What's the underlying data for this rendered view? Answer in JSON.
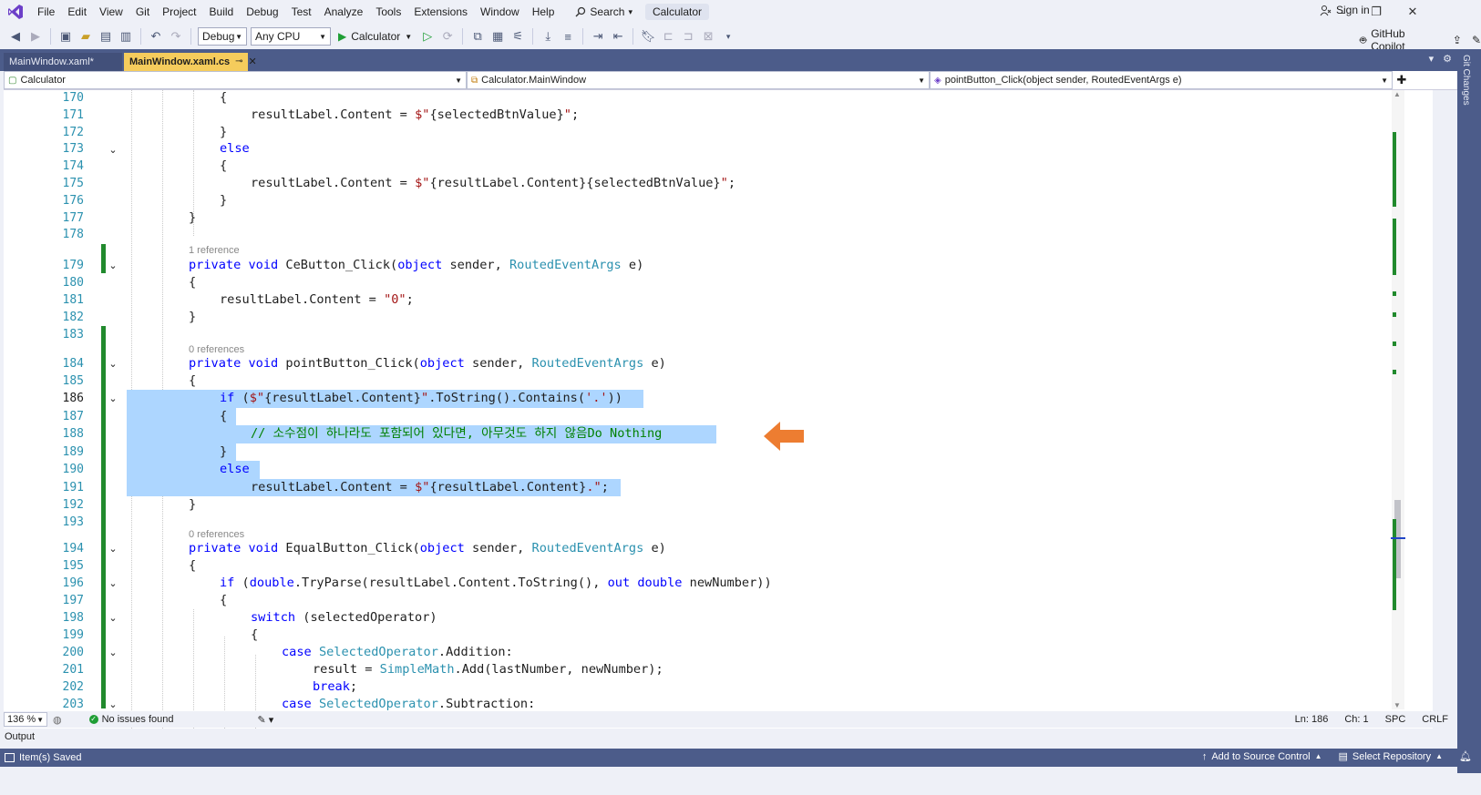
{
  "menu": [
    "File",
    "Edit",
    "View",
    "Git",
    "Project",
    "Build",
    "Debug",
    "Test",
    "Analyze",
    "Tools",
    "Extensions",
    "Window",
    "Help"
  ],
  "search_label": "Search",
  "solution_name": "Calculator",
  "sign_in": "Sign in",
  "toolbar": {
    "config": "Debug",
    "platform": "Any CPU",
    "run_target": "Calculator",
    "copilot": "GitHub Copilot"
  },
  "tabs": [
    {
      "label": "MainWindow.xaml*"
    },
    {
      "label": "MainWindow.xaml.cs"
    }
  ],
  "git_changes": "Git Changes",
  "nav": {
    "project": "Calculator",
    "type": "Calculator.MainWindow",
    "member": "pointButton_Click(object sender, RoutedEventArgs e)"
  },
  "lens": {
    "one_ref": "1 reference",
    "zero_ref": "0 references"
  },
  "line_numbers": [
    "170",
    "171",
    "172",
    "173",
    "174",
    "175",
    "176",
    "177",
    "178",
    "179",
    "180",
    "181",
    "182",
    "183",
    "184",
    "185",
    "186",
    "187",
    "188",
    "189",
    "190",
    "191",
    "192",
    "193",
    "194",
    "195",
    "196",
    "197",
    "198",
    "199",
    "200",
    "201",
    "202",
    "203"
  ],
  "code": {
    "l170": "{",
    "l171_a": "resultLabel.Content = ",
    "l171_b": "$\"",
    "l171_c": "{selectedBtnValue}",
    "l171_d": "\"",
    "l171_e": ";",
    "l172": "}",
    "l173": "else",
    "l174": "{",
    "l175_a": "resultLabel.Content = ",
    "l175_b": "$\"",
    "l175_c": "{resultLabel.Content}{selectedBtnValue}",
    "l175_d": "\"",
    "l175_e": ";",
    "l176": "}",
    "l177": "}",
    "kw_private": "private",
    "kw_void": "void",
    "kw_object": "object",
    "ty_args": "RoutedEventArgs",
    "l179_name": "CeButton_Click(",
    "l179_mid": " sender, ",
    "l179_end": " e)",
    "l180": "{",
    "l181_a": "resultLabel.Content = ",
    "l181_b": "\"0\"",
    "l181_c": ";",
    "l182": "}",
    "l184_name": "pointButton_Click(",
    "l185": "{",
    "l186_if": "if",
    "l186_a": " (",
    "l186_b": "$\"",
    "l186_c": "{resultLabel.Content}",
    "l186_d": "\"",
    "l186_e": ".ToString().Contains(",
    "l186_f": "'.'",
    "l186_g": "))",
    "l187": "{",
    "l188": "// 소수점이 하나라도 포함되어 있다면, 아무것도 하지 않음Do Nothing",
    "l189": "}",
    "l190": "else",
    "l191_a": "resultLabel.Content = ",
    "l191_b": "$\"",
    "l191_c": "{resultLabel.Content}",
    "l191_d": ".\"",
    "l191_e": ";",
    "l192": "}",
    "l194_name": "EqualButton_Click(",
    "l195": "{",
    "l196_if": "if",
    "l196_a": " (",
    "l196_double": "double",
    "l196_b": ".TryParse(resultLabel.Content.ToString(), ",
    "l196_out": "out",
    "l196_c": " newNumber))",
    "l197": "{",
    "l198_switch": "switch",
    "l198_a": " (selectedOperator)",
    "l199": "{",
    "l200_case": "case",
    "l200_ty": "SelectedOperator",
    "l200_a": ".Addition:",
    "l201_a": "result = ",
    "l201_ty": "SimpleMath",
    "l201_b": ".Add(lastNumber, newNumber);",
    "l202": "break",
    "l202_b": ";",
    "l203_a": ".Subtraction:"
  },
  "status": {
    "zoom": "136 %",
    "issues": "No issues found",
    "ln": "Ln: 186",
    "ch": "Ch: 1",
    "spc": "SPC",
    "crlf": "CRLF"
  },
  "output_label": "Output",
  "statusbar": {
    "saved": "Item(s) Saved",
    "source_control": "Add to Source Control",
    "repository": "Select Repository"
  },
  "colors": {
    "accent": "#4c5c8a",
    "active_tab": "#f5cc5c",
    "selection": "#add6ff",
    "change_bar": "#218a2d",
    "arrow": "#ed7d31"
  }
}
